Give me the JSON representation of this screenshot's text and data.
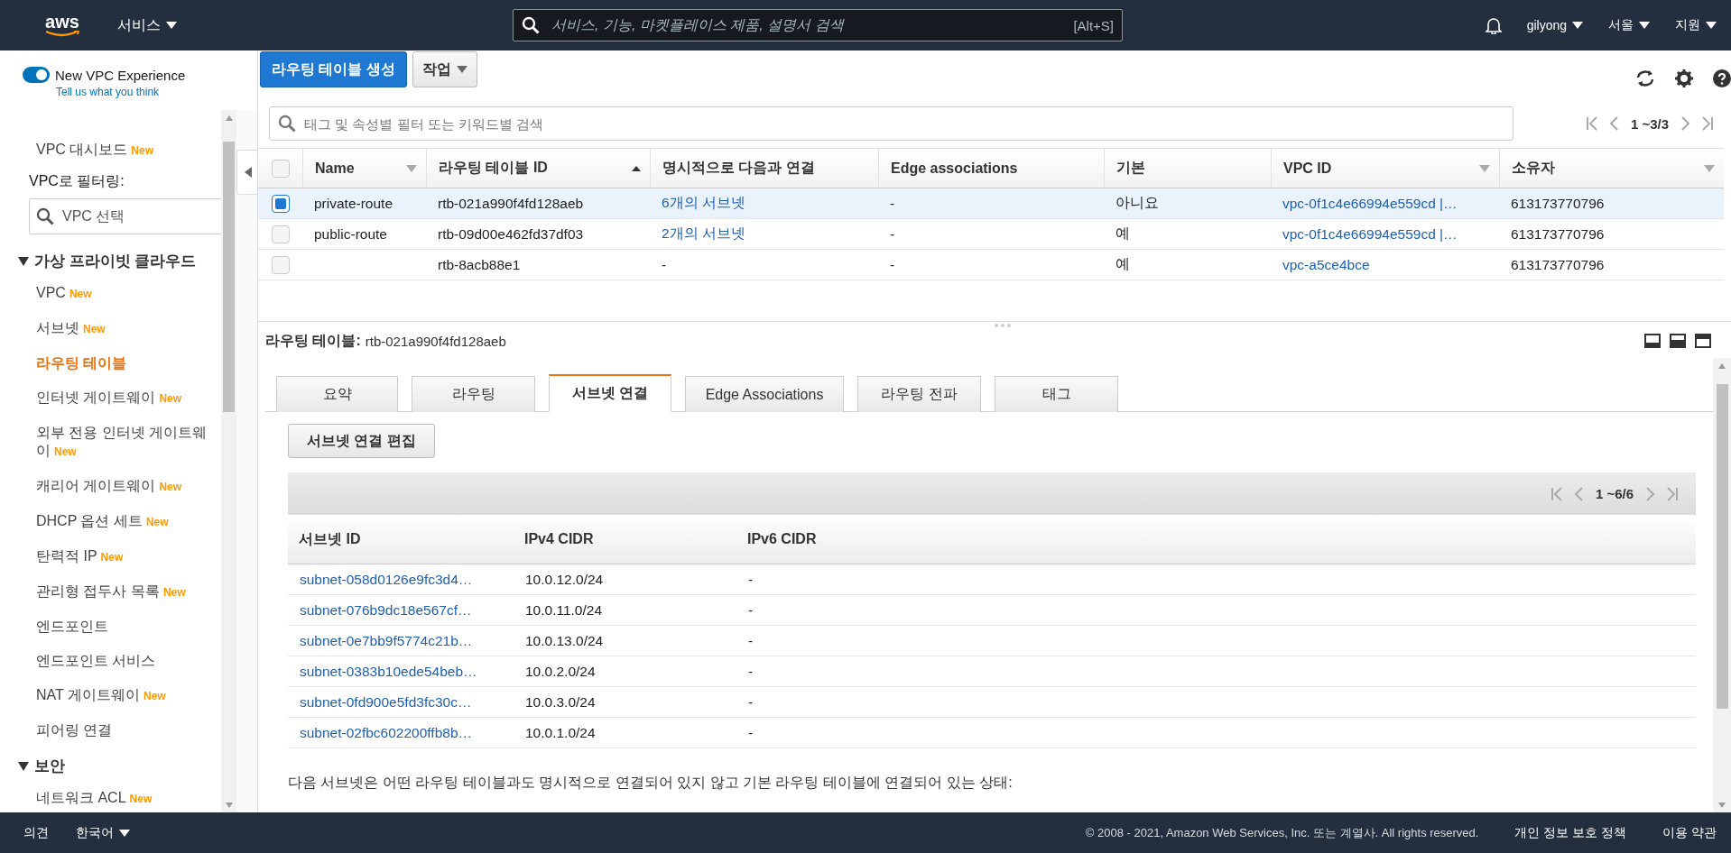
{
  "top_nav": {
    "logo": "aws",
    "services": "서비스",
    "search_placeholder": "서비스, 기능, 마켓플레이스 제품, 설명서 검색",
    "shortcut": "[Alt+S]",
    "user": "gilyong",
    "region": "서울",
    "support": "지원"
  },
  "sidebar": {
    "toggle": {
      "label": "New VPC Experience",
      "on": true
    },
    "feedback_link": "Tell us what you think",
    "dashboard": {
      "label": "VPC 대시보드",
      "badge": "New"
    },
    "filter_label": "VPC로 필터링:",
    "filter_placeholder": "VPC 선택",
    "sections": [
      {
        "title": "가상 프라이빗 클라우드",
        "expanded": true,
        "items": [
          {
            "label": "VPC",
            "badge": "New",
            "selected": false
          },
          {
            "label": "서브넷",
            "badge": "New",
            "selected": false
          },
          {
            "label": "라우팅 테이블",
            "selected": true
          },
          {
            "label": "인터넷 게이트웨이",
            "badge": "New",
            "selected": false
          },
          {
            "label": "외부 전용 인터넷 게이트웨이",
            "badge": "New",
            "selected": false
          },
          {
            "label": "캐리어 게이트웨이",
            "badge": "New",
            "selected": false
          },
          {
            "label": "DHCP 옵션 세트",
            "badge": "New",
            "selected": false
          },
          {
            "label": "탄력적 IP",
            "badge": "New",
            "selected": false
          },
          {
            "label": "관리형 접두사 목록",
            "badge": "New",
            "selected": false
          },
          {
            "label": "엔드포인트",
            "selected": false
          },
          {
            "label": "엔드포인트 서비스",
            "selected": false
          },
          {
            "label": "NAT 게이트웨이",
            "badge": "New",
            "selected": false
          },
          {
            "label": "피어링 연결",
            "selected": false
          }
        ]
      },
      {
        "title": "보안",
        "expanded": true,
        "items": [
          {
            "label": "네트워크 ACL",
            "badge": "New",
            "selected": false
          }
        ]
      }
    ]
  },
  "toolbar": {
    "create_button": "라우팅 테이블 생성",
    "actions_button": "작업"
  },
  "filter": {
    "placeholder": "태그 및 속성별 필터 또는 키워드별 검색",
    "range": "1 ~3/3"
  },
  "table": {
    "select_all": {
      "checked": false
    },
    "columns": [
      {
        "label": "Name",
        "sortable": true,
        "sorted": false
      },
      {
        "label": "라우팅 테이블 ID",
        "sortable": true,
        "sorted": true
      },
      {
        "label": "명시적으로 다음과 연결",
        "sortable": false
      },
      {
        "label": "Edge associations",
        "sortable": false
      },
      {
        "label": "기본",
        "sortable": false
      },
      {
        "label": "VPC ID",
        "sortable": true,
        "sorted": false
      },
      {
        "label": "소유자",
        "sortable": true,
        "sorted": false
      }
    ],
    "rows": [
      {
        "selected": true,
        "name": "private-route",
        "id": "rtb-021a990f4fd128aeb",
        "associations": "6개의 서브넷",
        "edge": "-",
        "main": "아니요",
        "vpc": "vpc-0f1c4e66994e559cd |…",
        "owner": "613173770796"
      },
      {
        "selected": false,
        "name": "public-route",
        "id": "rtb-09d00e462fd37df03",
        "associations": "2개의 서브넷",
        "edge": "-",
        "main": "예",
        "vpc": "vpc-0f1c4e66994e559cd |…",
        "owner": "613173770796"
      },
      {
        "selected": false,
        "id": "rtb-8acb88e1",
        "associations": "-",
        "edge": "-",
        "main": "예",
        "vpc": "vpc-a5ce4bce",
        "owner": "613173770796"
      }
    ]
  },
  "details": {
    "label": "라우팅 테이블:",
    "value": "rtb-021a990f4fd128aeb",
    "tabs": [
      {
        "label": "요약",
        "selected": false
      },
      {
        "label": "라우팅",
        "selected": false
      },
      {
        "label": "서브넷 연결",
        "selected": true
      },
      {
        "label": "Edge Associations",
        "selected": false
      },
      {
        "label": "라우팅 전파",
        "selected": false
      },
      {
        "label": "태그",
        "selected": false
      }
    ],
    "edit_button": "서브넷 연결 편집",
    "range": "1 ~6/6",
    "columns": [
      "서브넷 ID",
      "IPv4 CIDR",
      "IPv6 CIDR"
    ],
    "rows": [
      {
        "subnet": "subnet-058d0126e9fc3d4…",
        "ipv4": "10.0.12.0/24",
        "ipv6": "-"
      },
      {
        "subnet": "subnet-076b9dc18e567cf…",
        "ipv4": "10.0.11.0/24",
        "ipv6": "-"
      },
      {
        "subnet": "subnet-0e7bb9f5774c21b…",
        "ipv4": "10.0.13.0/24",
        "ipv6": "-"
      },
      {
        "subnet": "subnet-0383b10ede54beb…",
        "ipv4": "10.0.2.0/24",
        "ipv6": "-"
      },
      {
        "subnet": "subnet-0fd900e5fd3fc30c…",
        "ipv4": "10.0.3.0/24",
        "ipv6": "-"
      },
      {
        "subnet": "subnet-02fbc602200ffb8b…",
        "ipv4": "10.0.1.0/24",
        "ipv6": "-"
      }
    ],
    "note": "다음 서브넷은 어떤 라우팅 테이블과도 명시적으로 연결되어 있지 않고 기본 라우팅 테이블에 연결되어 있는 상태:"
  },
  "footer": {
    "feedback": "의견",
    "language": "한국어",
    "copyright": "© 2008 - 2021, Amazon Web Services, Inc. 또는 계열사. All rights reserved.",
    "links": [
      "개인 정보 보호 정책",
      "이용 약관"
    ]
  }
}
